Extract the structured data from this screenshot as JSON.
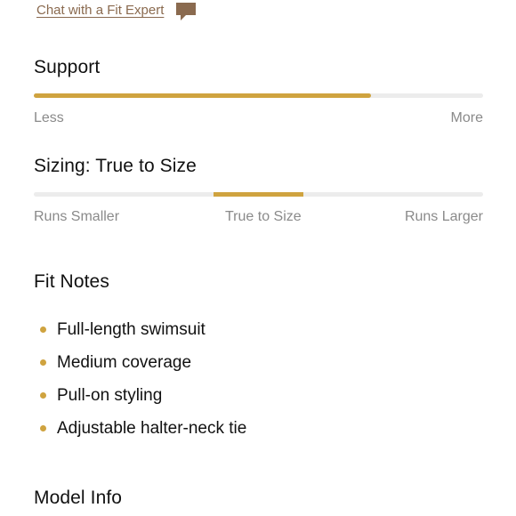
{
  "chat": {
    "link_text": "Chat with a Fit Expert",
    "icon": "chat-bubble-icon"
  },
  "support": {
    "title": "Support",
    "level": 0.75,
    "min_label": "Less",
    "max_label": "More"
  },
  "sizing": {
    "title": "Sizing: True to Size",
    "position": 0.5,
    "left_label": "Runs Smaller",
    "center_label": "True to Size",
    "right_label": "Runs Larger"
  },
  "fit_notes": {
    "title": "Fit Notes",
    "items": [
      "Full-length swimsuit",
      "Medium coverage",
      "Pull-on styling",
      "Adjustable halter-neck tie"
    ]
  },
  "model_info": {
    "title": "Model Info"
  },
  "colors": {
    "accent": "#cfa33f",
    "link": "#8a6a4f",
    "track": "#ececec",
    "muted_text": "#8a8a8a"
  }
}
